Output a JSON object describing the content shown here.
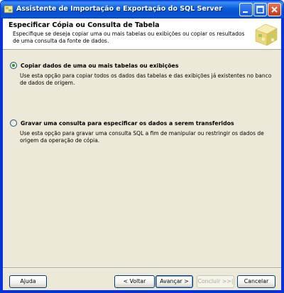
{
  "window": {
    "title": "Assistente de Importação e Exportação do SQL Server"
  },
  "header": {
    "title": "Especificar Cópia ou Consulta de Tabela",
    "description": "Especifique se deseja copiar uma ou mais tabelas ou exibições ou copiar os resultados de uma consulta da fonte de dados."
  },
  "options": [
    {
      "label": "Copiar dados de uma ou mais tabelas ou exibições",
      "description": "Use esta opção para copiar todos os dados das tabelas e das exibições já existentes no banco de dados de origem.",
      "selected": true
    },
    {
      "label": "Gravar uma consulta para especificar os dados a serem transferidos",
      "description": "Use esta opção para gravar uma consulta SQL a fim de manipular ou restringir os dados de origem da operação de cópia.",
      "selected": false
    }
  ],
  "buttons": {
    "help": "Ajuda",
    "back": "< Voltar",
    "next": "Avançar >",
    "finish": "Concluir >>|",
    "cancel": "Cancelar"
  },
  "colors": {
    "titlebar": "#0a5ad6",
    "selected_radio_dot": "#21a121",
    "dialog_background": "#ece9d8"
  },
  "icons": {
    "app": "sql-server-wizard-icon",
    "header": "database-wizard-graphic"
  }
}
